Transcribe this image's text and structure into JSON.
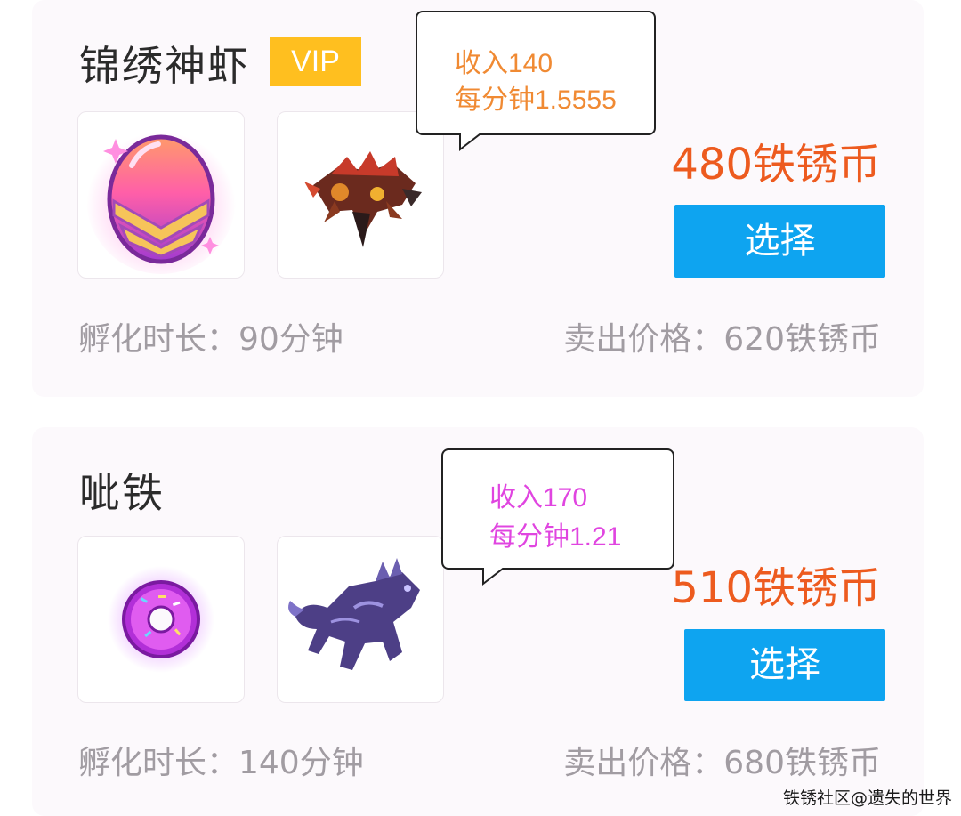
{
  "cards": [
    {
      "name": "锦绣神虾",
      "badge": "VIP",
      "tooltip": {
        "line1": "收入140",
        "line2": "每分钟1.5555",
        "color": "#f08a33"
      },
      "price": "480铁锈币",
      "select_label": "选择",
      "hatch_time": "孵化时长：90分钟",
      "sell_price": "卖出价格：620铁锈币",
      "egg_icon": "pink-gold-egg-icon",
      "creature_icon": "red-armored-shrimp-icon"
    },
    {
      "name": "呲铁",
      "tooltip": {
        "line1": "收入170",
        "line2": "每分钟1.21",
        "color": "#e045e0"
      },
      "price": "510铁锈币",
      "select_label": "选择",
      "hatch_time": "孵化时长：140分钟",
      "sell_price": "卖出价格：680铁锈币",
      "egg_icon": "purple-donut-icon",
      "creature_icon": "purple-dragon-beast-icon"
    }
  ],
  "watermark": "铁锈社区@遗失的世界",
  "colors": {
    "accent_price": "#ed5b1f",
    "button": "#0ea4f0",
    "vip_badge": "#ffbf1f"
  }
}
